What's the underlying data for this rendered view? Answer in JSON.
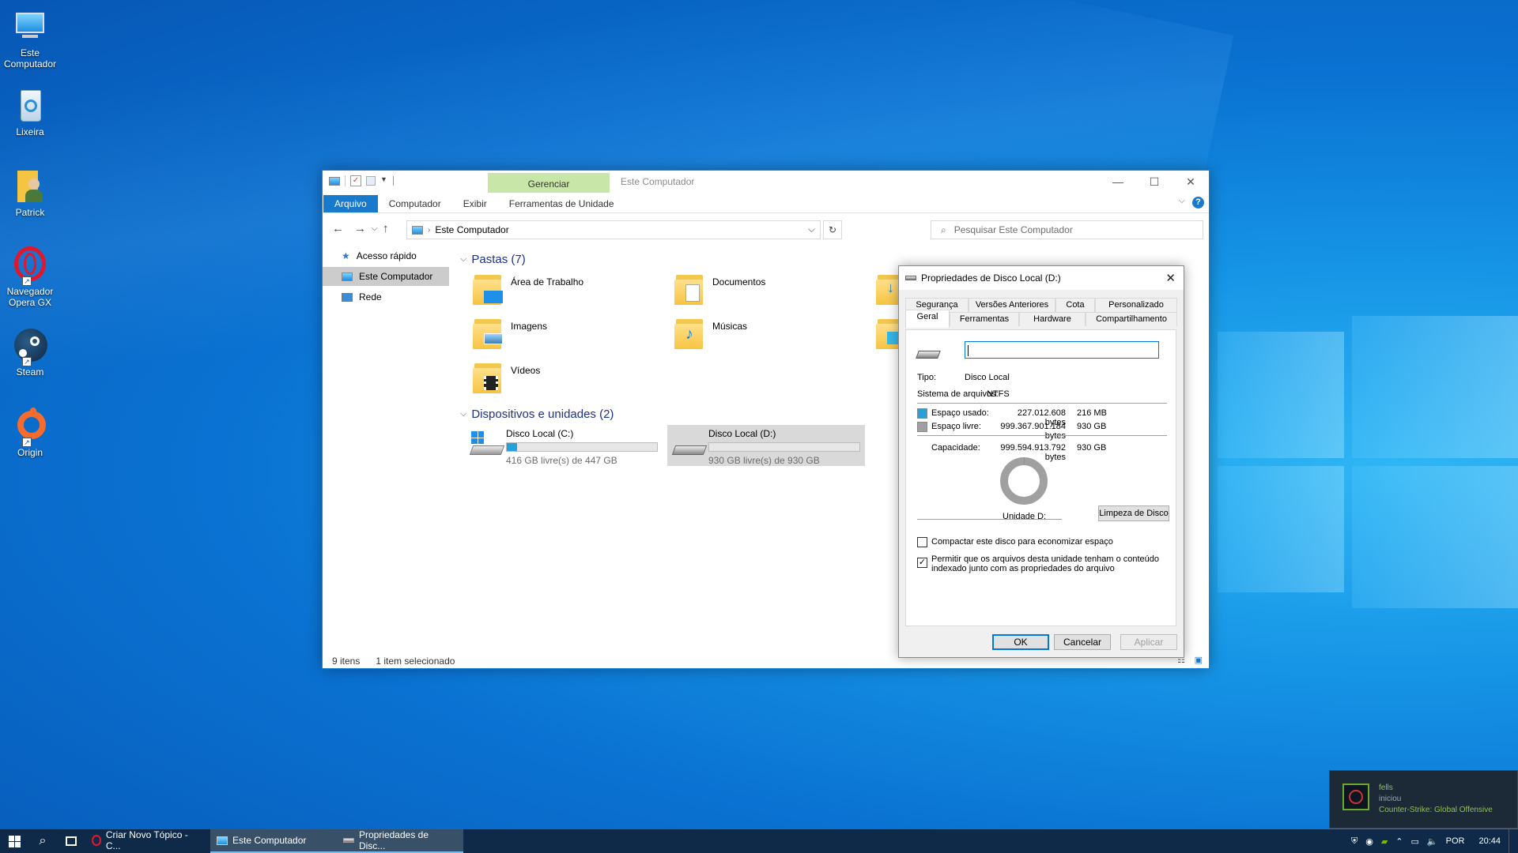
{
  "desktop": {
    "icons": [
      {
        "label": "Este Computador",
        "icon": "computer-icon"
      },
      {
        "label": "Lixeira",
        "icon": "recycle-bin-icon"
      },
      {
        "label": "Patrick",
        "icon": "user-folder-icon"
      },
      {
        "label": "Navegador Opera GX",
        "icon": "opera-gx-icon"
      },
      {
        "label": "Steam",
        "icon": "steam-icon"
      },
      {
        "label": "Origin",
        "icon": "origin-icon"
      }
    ]
  },
  "explorer": {
    "title": "Este Computador",
    "context_tab": "Gerenciar",
    "ribbon_tabs": [
      "Arquivo",
      "Computador",
      "Exibir",
      "Ferramentas de Unidade"
    ],
    "address": "Este Computador",
    "search_placeholder": "Pesquisar Este Computador",
    "nav": [
      "Acesso rápido",
      "Este Computador",
      "Rede"
    ],
    "folders_header": "Pastas (7)",
    "folders": [
      "Área de Trabalho",
      "Documentos",
      "Imagens",
      "Músicas",
      "Vídeos"
    ],
    "devices_header": "Dispositivos e unidades (2)",
    "drives": [
      {
        "name": "Disco Local (C:)",
        "free": "416 GB livre(s) de 447 GB",
        "used_fraction": 0.07
      },
      {
        "name": "Disco Local (D:)",
        "free": "930 GB livre(s) de 930 GB",
        "used_fraction": 0.0
      }
    ],
    "status": {
      "items": "9 itens",
      "selected": "1 item selecionado"
    }
  },
  "dialog": {
    "title": "Propriedades de Disco Local (D:)",
    "tabs_top": [
      "Segurança",
      "Versões Anteriores",
      "Cota",
      "Personalizado"
    ],
    "tabs_bottom": [
      "Geral",
      "Ferramentas",
      "Hardware",
      "Compartilhamento"
    ],
    "name_value": "",
    "tipo_label": "Tipo:",
    "tipo_value": "Disco Local",
    "fs_label": "Sistema de arquivos:",
    "fs_value": "NTFS",
    "used_label": "Espaço usado:",
    "used_bytes": "227.012.608 bytes",
    "used_size": "216 MB",
    "free_label": "Espaço livre:",
    "free_bytes": "999.367.901.184 bytes",
    "free_size": "930 GB",
    "cap_label": "Capacidade:",
    "cap_bytes": "999.594.913.792 bytes",
    "cap_size": "930 GB",
    "unit_label": "Unidade D:",
    "cleanup_label": "Limpeza de Disco",
    "compress_label": "Compactar este disco para economizar espaço",
    "index_label": "Permitir que os arquivos desta unidade tenham o conteúdo indexado junto com as propriedades do arquivo",
    "ok": "OK",
    "cancel": "Cancelar",
    "apply": "Aplicar",
    "colors": {
      "used": "#26a0da",
      "free": "#a0a0a0"
    }
  },
  "taskbar": {
    "apps": [
      "Criar Novo Tópico - C...",
      "Este Computador",
      "Propriedades de Disc..."
    ],
    "lang": "POR",
    "time": "20:44"
  },
  "notification": {
    "user": "fells",
    "action": "iniciou",
    "game": "Counter-Strike: Global Offensive"
  }
}
